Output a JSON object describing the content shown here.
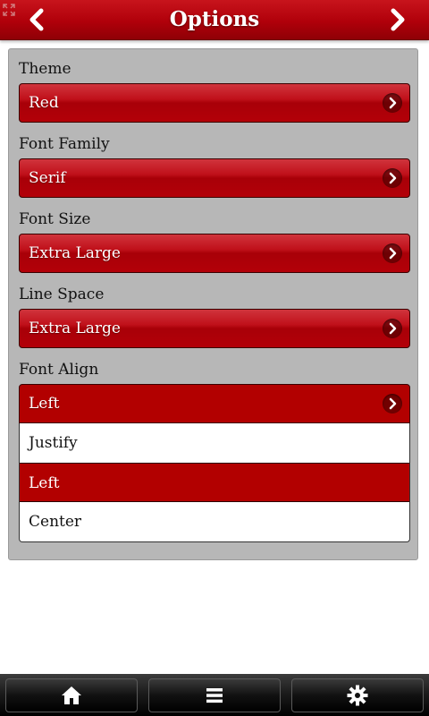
{
  "header": {
    "title": "Options",
    "back_icon": "chevron-left-icon",
    "forward_icon": "chevron-right-icon",
    "expand_icon": "expand-arrows-icon"
  },
  "settings": [
    {
      "label": "Theme",
      "value": "Red"
    },
    {
      "label": "Font Family",
      "value": "Serif"
    },
    {
      "label": "Font Size",
      "value": "Extra Large"
    },
    {
      "label": "Line Space",
      "value": "Extra Large"
    },
    {
      "label": "Font Align",
      "value": "Left"
    }
  ],
  "font_align_options": [
    {
      "label": "Justify",
      "selected": false
    },
    {
      "label": "Left",
      "selected": true
    },
    {
      "label": "Center",
      "selected": false
    }
  ],
  "toolbar": {
    "home_icon": "home-icon",
    "menu_icon": "list-menu-icon",
    "settings_icon": "gear-icon"
  },
  "colors": {
    "accent": "#b20000",
    "panel": "#b7b7b7",
    "toolbar": "#111111"
  }
}
